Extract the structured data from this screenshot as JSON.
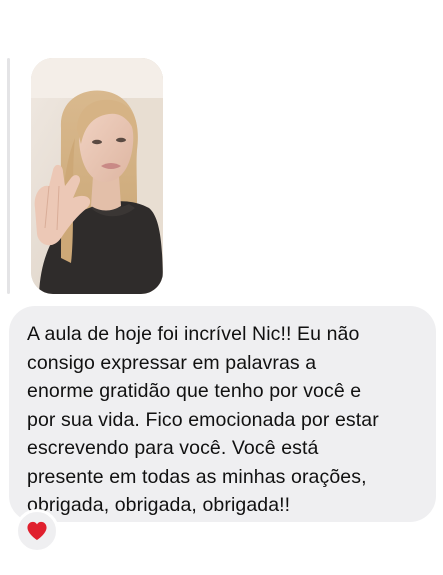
{
  "story_reply": {
    "thumbnail_alt": "story-photo-woman"
  },
  "message": {
    "text": "A aula de hoje foi incrível Nic!! Eu não\nconsigo expressar em palavras a\nenorme gratidão que tenho por você e\npor sua vida. Fico emocionada por estar\nescrevendo para você. Você está\npresente em todas as minhas orações,\nobrigada, obrigada, obrigada!!"
  },
  "reaction": {
    "icon": "heart-icon",
    "color": "#e0202e"
  },
  "colors": {
    "bubble_bg": "#efeff1",
    "text": "#111111",
    "reply_bar": "#e4e4e6"
  }
}
